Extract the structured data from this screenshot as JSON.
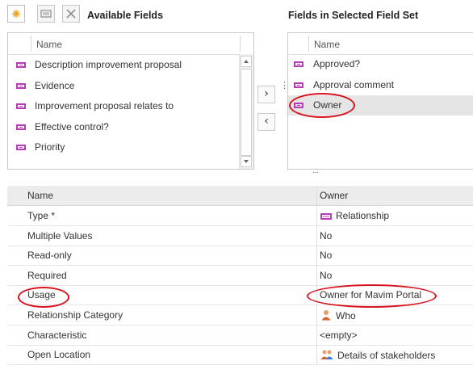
{
  "toolbar": {
    "new_icon": "star-icon",
    "edit_icon": "panel-icon",
    "delete_icon": "close-icon",
    "available_title": "Available Fields",
    "selected_title": "Fields in Selected Field Set"
  },
  "available": {
    "column_header": "Name",
    "items": [
      {
        "label": "Description improvement proposal"
      },
      {
        "label": "Evidence"
      },
      {
        "label": "Improvement proposal relates to"
      },
      {
        "label": "Effective control?"
      },
      {
        "label": "Priority"
      }
    ]
  },
  "selected": {
    "column_header": "Name",
    "items": [
      {
        "label": "Approved?"
      },
      {
        "label": "Approval comment"
      },
      {
        "label": "Owner"
      }
    ],
    "selected_index": 2
  },
  "move": {
    "add_symbol": "›",
    "remove_symbol": "‹",
    "splitter": "⋮",
    "splitter_h": "···"
  },
  "properties": {
    "header_name": "Name",
    "header_value": "Owner",
    "rows": [
      {
        "name": "Type *",
        "value": "Relationship",
        "icon": "relationship-icon"
      },
      {
        "name": "Multiple Values",
        "value": "No"
      },
      {
        "name": "Read-only",
        "value": "No"
      },
      {
        "name": "Required",
        "value": "No"
      },
      {
        "name": "Usage",
        "value": "Owner for Mavim Portal"
      },
      {
        "name": "Relationship Category",
        "value": "Who",
        "icon": "person-icon"
      },
      {
        "name": "Characteristic",
        "value": "<empty>"
      },
      {
        "name": "Open Location",
        "value": "Details of stakeholders",
        "icon": "people-icon"
      }
    ]
  },
  "colors": {
    "field_icon": "#b63cb6",
    "annotation": "#d8141e",
    "selected_row": "#e5e5e5"
  }
}
